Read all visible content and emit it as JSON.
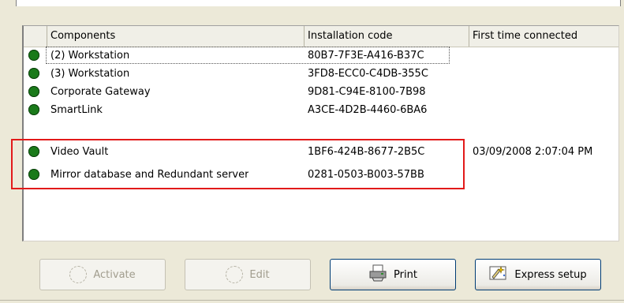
{
  "table": {
    "columns": [
      "Components",
      "Installation code",
      "First time connected"
    ],
    "rows": [
      {
        "component": "(2)  Workstation",
        "code": "80B7-7F3E-A416-B37C",
        "first_connected": "",
        "status": "online"
      },
      {
        "component": "(3)  Workstation",
        "code": "3FD8-ECC0-C4DB-355C",
        "first_connected": "",
        "status": "online"
      },
      {
        "component": "Corporate Gateway",
        "code": "9D81-C94E-8100-7B98",
        "first_connected": "",
        "status": "online"
      },
      {
        "component": "SmartLink",
        "code": "A3CE-4D2B-4460-6BA6",
        "first_connected": "",
        "status": "online"
      },
      {
        "component": "Video Vault",
        "code": "1BF6-424B-8677-2B5C",
        "first_connected": "03/09/2008 2:07:04 PM",
        "status": "online"
      },
      {
        "component": "Mirror database and Redundant server",
        "code": "0281-0503-B003-57BB",
        "first_connected": "",
        "status": "online"
      }
    ]
  },
  "buttons": {
    "activate": {
      "label": "Activate",
      "icon": "empty-circle-icon",
      "enabled": false
    },
    "edit": {
      "label": "Edit",
      "icon": "empty-circle-icon",
      "enabled": false
    },
    "print": {
      "label": "Print",
      "icon": "printer-icon",
      "enabled": true
    },
    "express": {
      "label": "Express setup",
      "icon": "wizard-icon",
      "enabled": true
    }
  },
  "colors": {
    "status_online": "#1a7a1a",
    "annotation_box": "#e21a1a"
  }
}
